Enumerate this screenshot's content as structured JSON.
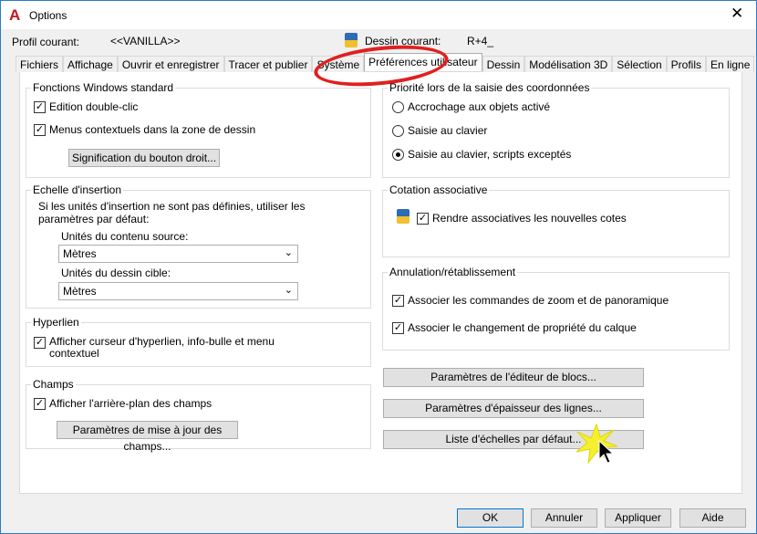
{
  "window": {
    "title": "Options",
    "logo": "A",
    "close": "✕"
  },
  "profile": {
    "label": "Profil courant:",
    "value": "<<VANILLA>>",
    "drawing_label": "Dessin courant:",
    "drawing_value": "R+4_"
  },
  "tabs": [
    "Fichiers",
    "Affichage",
    "Ouvrir et enregistrer",
    "Tracer et publier",
    "Système",
    "Préférences utilisateur",
    "Dessin",
    "Modélisation 3D",
    "Sélection",
    "Profils",
    "En ligne"
  ],
  "active_tab": "Préférences utilisateur",
  "windows": {
    "title": "Fonctions Windows standard",
    "dblclick": "Edition double-clic",
    "context": "Menus contextuels dans la zone de dessin",
    "right_button": "Signification du bouton droit..."
  },
  "insert_scale": {
    "title": "Echelle d'insertion",
    "desc1": "Si les unités d'insertion ne sont pas définies, utiliser les",
    "desc2": "paramètres par défaut:",
    "source_label": "Unités du contenu source:",
    "source_value": "Mètres",
    "target_label": "Unités du dessin cible:",
    "target_value": "Mètres"
  },
  "hyperlink": {
    "title": "Hyperlien",
    "option1": "Afficher curseur d'hyperlien, info-bulle et menu",
    "option2": "contextuel"
  },
  "fields": {
    "title": "Champs",
    "option": "Afficher l'arrière-plan des champs",
    "button": "Paramètres de mise à jour des champs..."
  },
  "priority": {
    "title": "Priorité lors de la saisie des coordonnées",
    "options": [
      "Accrochage aux objets activé",
      "Saisie au clavier",
      "Saisie au clavier, scripts exceptés"
    ],
    "selected": 2
  },
  "assoc": {
    "title": "Cotation associative",
    "option": "Rendre associatives les nouvelles cotes"
  },
  "undo": {
    "title": "Annulation/rétablissement",
    "option1": "Associer les commandes de zoom et de panoramique",
    "option2": "Associer le changement de propriété du calque"
  },
  "buttons": {
    "block_editor": "Paramètres de l'éditeur de blocs...",
    "lineweight": "Paramètres d'épaisseur des lignes...",
    "scale_list": "Liste d'échelles par défaut..."
  },
  "footer": {
    "ok": "OK",
    "cancel": "Annuler",
    "apply": "Appliquer",
    "help": "Aide"
  },
  "check": "✓"
}
